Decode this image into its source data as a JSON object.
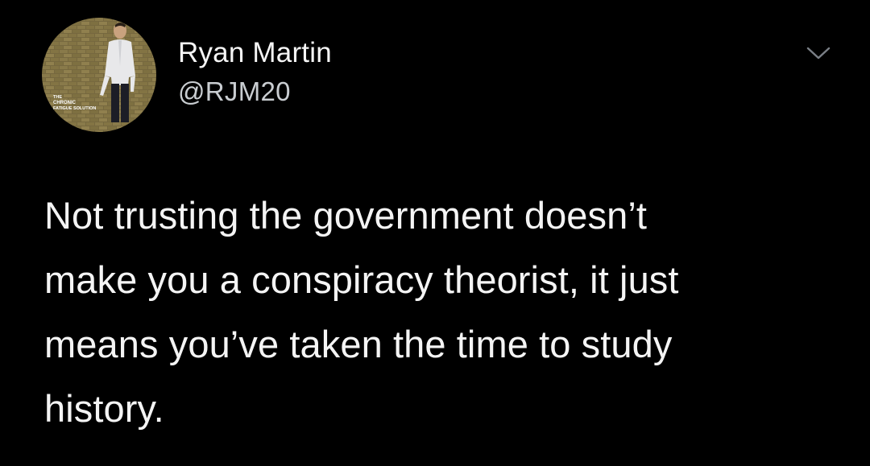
{
  "tweet": {
    "author": {
      "display_name": "Ryan Martin",
      "handle": "@RJM20"
    },
    "avatar": {
      "overlay_text": [
        "THE",
        "CHRONIC",
        "FATIGUE SOLUTION"
      ]
    },
    "more_icon": "chevron-down-icon",
    "text_lines": [
      "Not trusting the government doesn’t",
      "make you a conspiracy theorist, it just",
      "means you’ve taken the time to study",
      "history."
    ]
  },
  "colors": {
    "background": "#000000",
    "primary_text": "#f5f5f5",
    "secondary_text": "#c9cdd1",
    "chevron": "#7a7f86"
  }
}
